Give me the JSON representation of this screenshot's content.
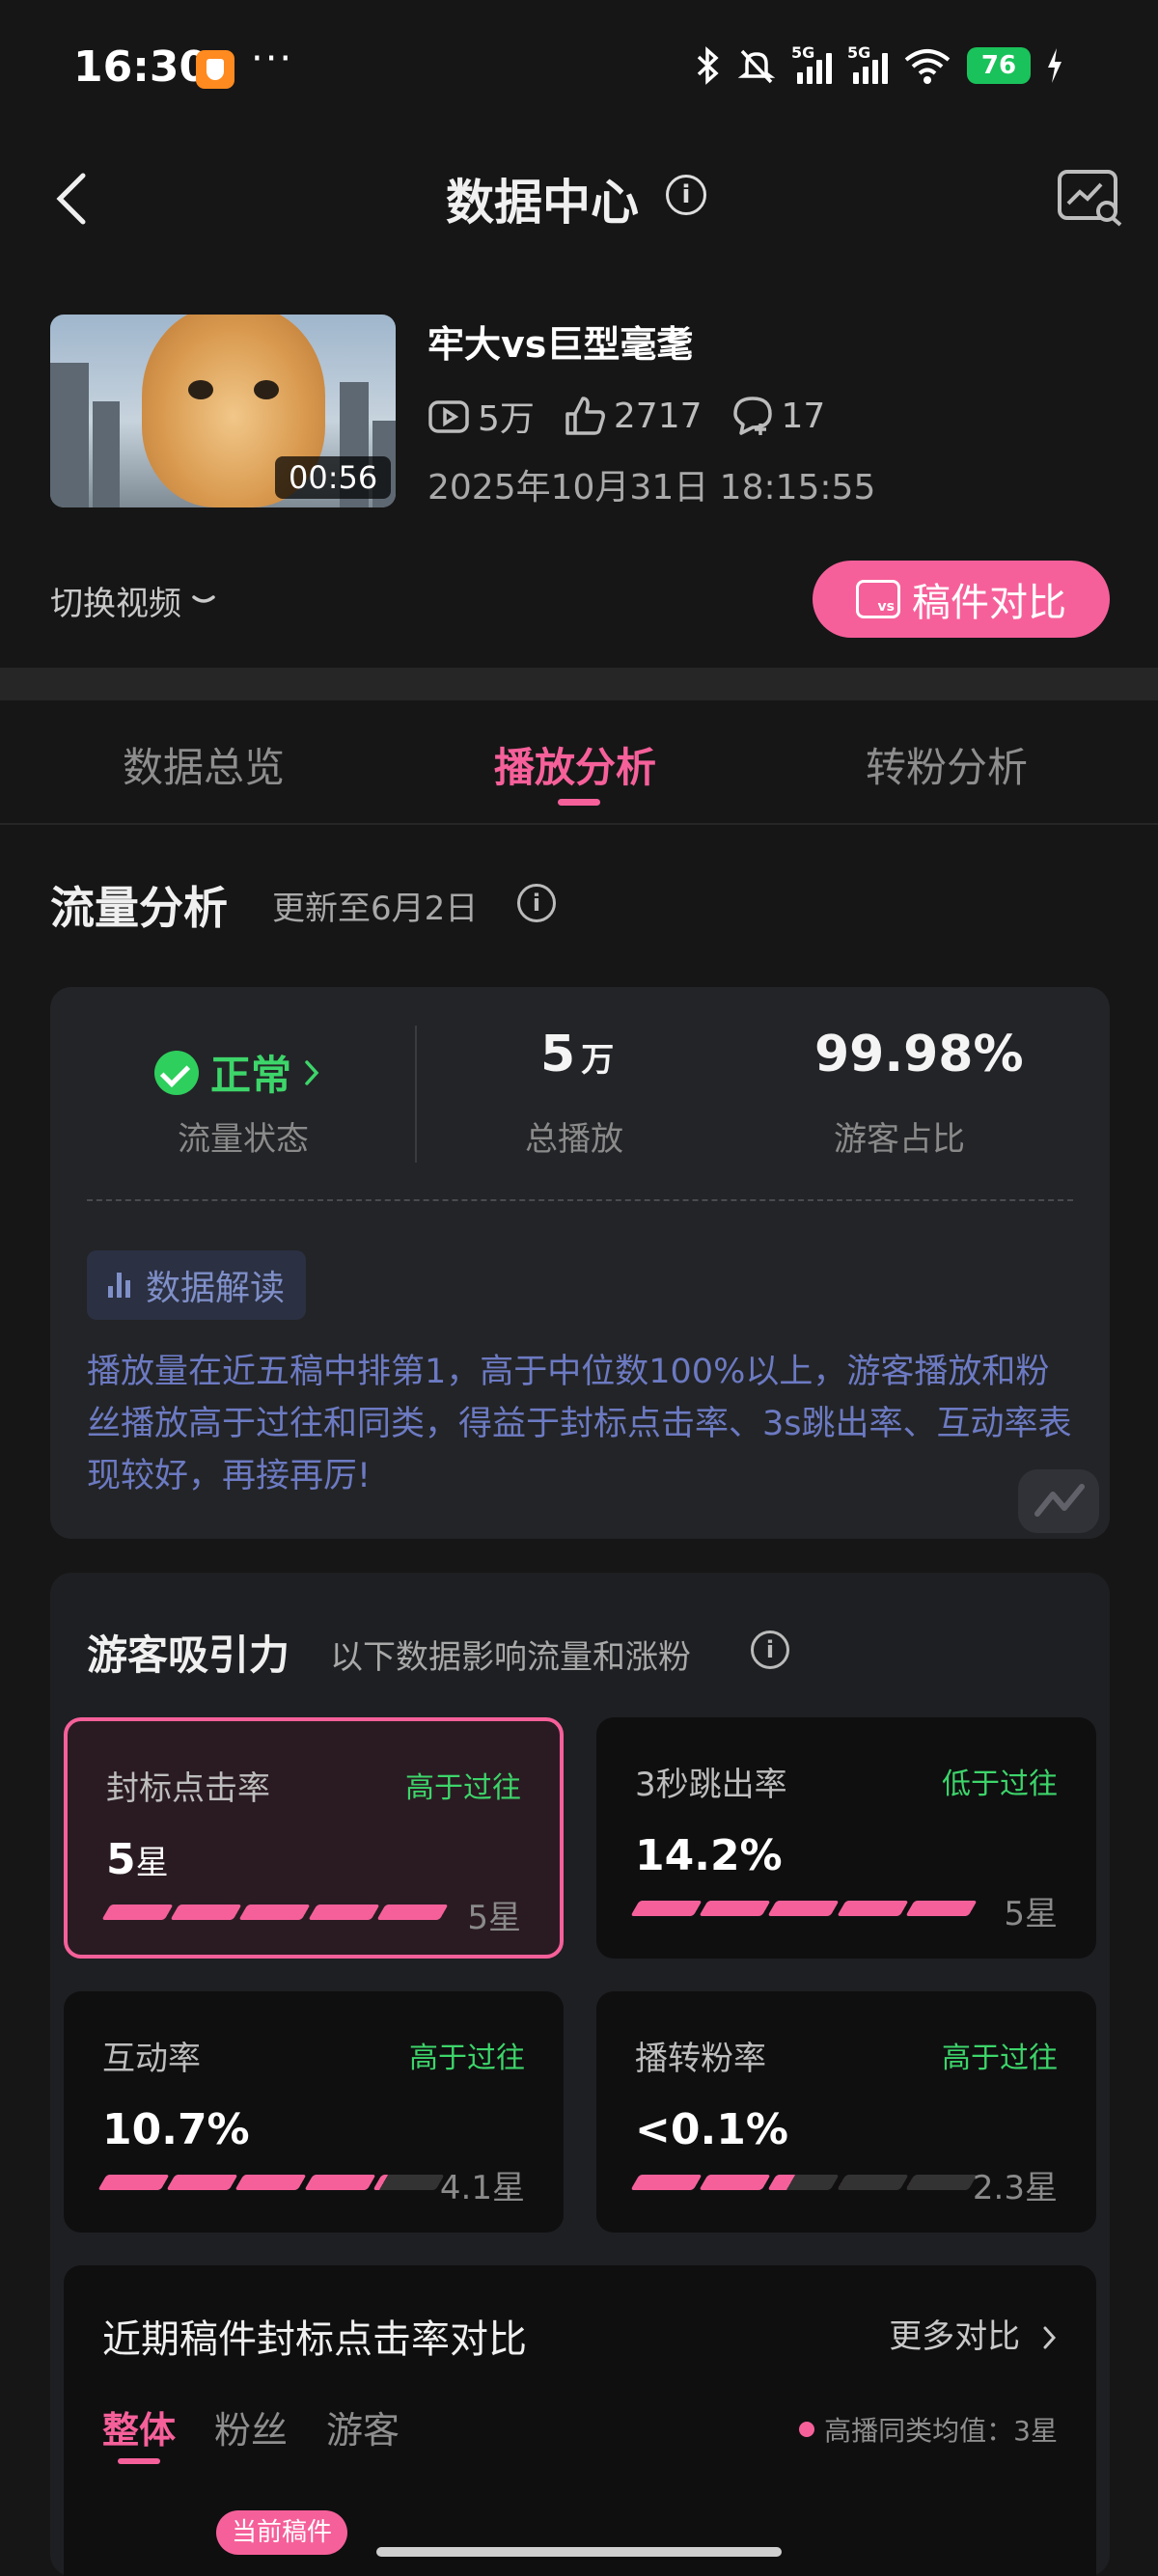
{
  "status_bar": {
    "time": "16:30",
    "more": "···",
    "battery": "76",
    "network": [
      "5G",
      "5G"
    ],
    "icons": [
      "bluetooth-icon",
      "mute-icon",
      "signal-icon",
      "wifi-icon",
      "charging-icon"
    ]
  },
  "header": {
    "title": "数据中心",
    "info": "i"
  },
  "video": {
    "title": "牢大vs巨型毫耄",
    "duration": "00:56",
    "plays": "5万",
    "likes": "2717",
    "comments": "17",
    "published": "2025年10月31日 18:15:55",
    "switch_label": "切换视频",
    "compare_label": "稿件对比",
    "compare_icon_text": "vs"
  },
  "tabs": [
    {
      "label": "数据总览"
    },
    {
      "label": "播放分析"
    },
    {
      "label": "转粉分析"
    }
  ],
  "traffic": {
    "title": "流量分析",
    "updated": "更新至6月2日",
    "status_value": "正常",
    "status_label": "流量状态",
    "total_plays_value": "5",
    "total_plays_unit": "万",
    "total_plays_label": "总播放",
    "visitor_ratio_value": "99.98%",
    "visitor_ratio_label": "游客占比",
    "interp_label": "数据解读",
    "interp_text": "播放量在近五稿中排第1，高于中位数100%以上，游客播放和粉丝播放高于过往和同类，得益于封标点击率、3s跳出率、互动率表现较好，再接再厉!"
  },
  "attraction": {
    "title": "游客吸引力",
    "subtitle": "以下数据影响流量和涨粉",
    "metrics": [
      {
        "name": "封标点击率",
        "trend": "高于过往",
        "value": "5",
        "value_unit": "星",
        "stars": "5星",
        "score": 5
      },
      {
        "name": "3秒跳出率",
        "trend": "低于过往",
        "value": "14.2%",
        "value_unit": "",
        "stars": "5星",
        "score": 5
      },
      {
        "name": "互动率",
        "trend": "高于过往",
        "value": "10.7%",
        "value_unit": "",
        "stars": "4.1星",
        "score": 4.1
      },
      {
        "name": "播转粉率",
        "trend": "高于过往",
        "value": "<0.1%",
        "value_unit": "",
        "stars": "2.3星",
        "score": 2.3
      }
    ]
  },
  "comparison": {
    "title": "近期稿件封标点击率对比",
    "more": "更多对比",
    "subtabs": [
      "整体",
      "粉丝",
      "游客"
    ],
    "legend": "高播同类均值：3星",
    "current_tag": "当前稿件"
  },
  "colors": {
    "accent": "#f6609a",
    "positive": "#3dd56a",
    "interp": "#6c7ac2",
    "background": "#161616"
  }
}
